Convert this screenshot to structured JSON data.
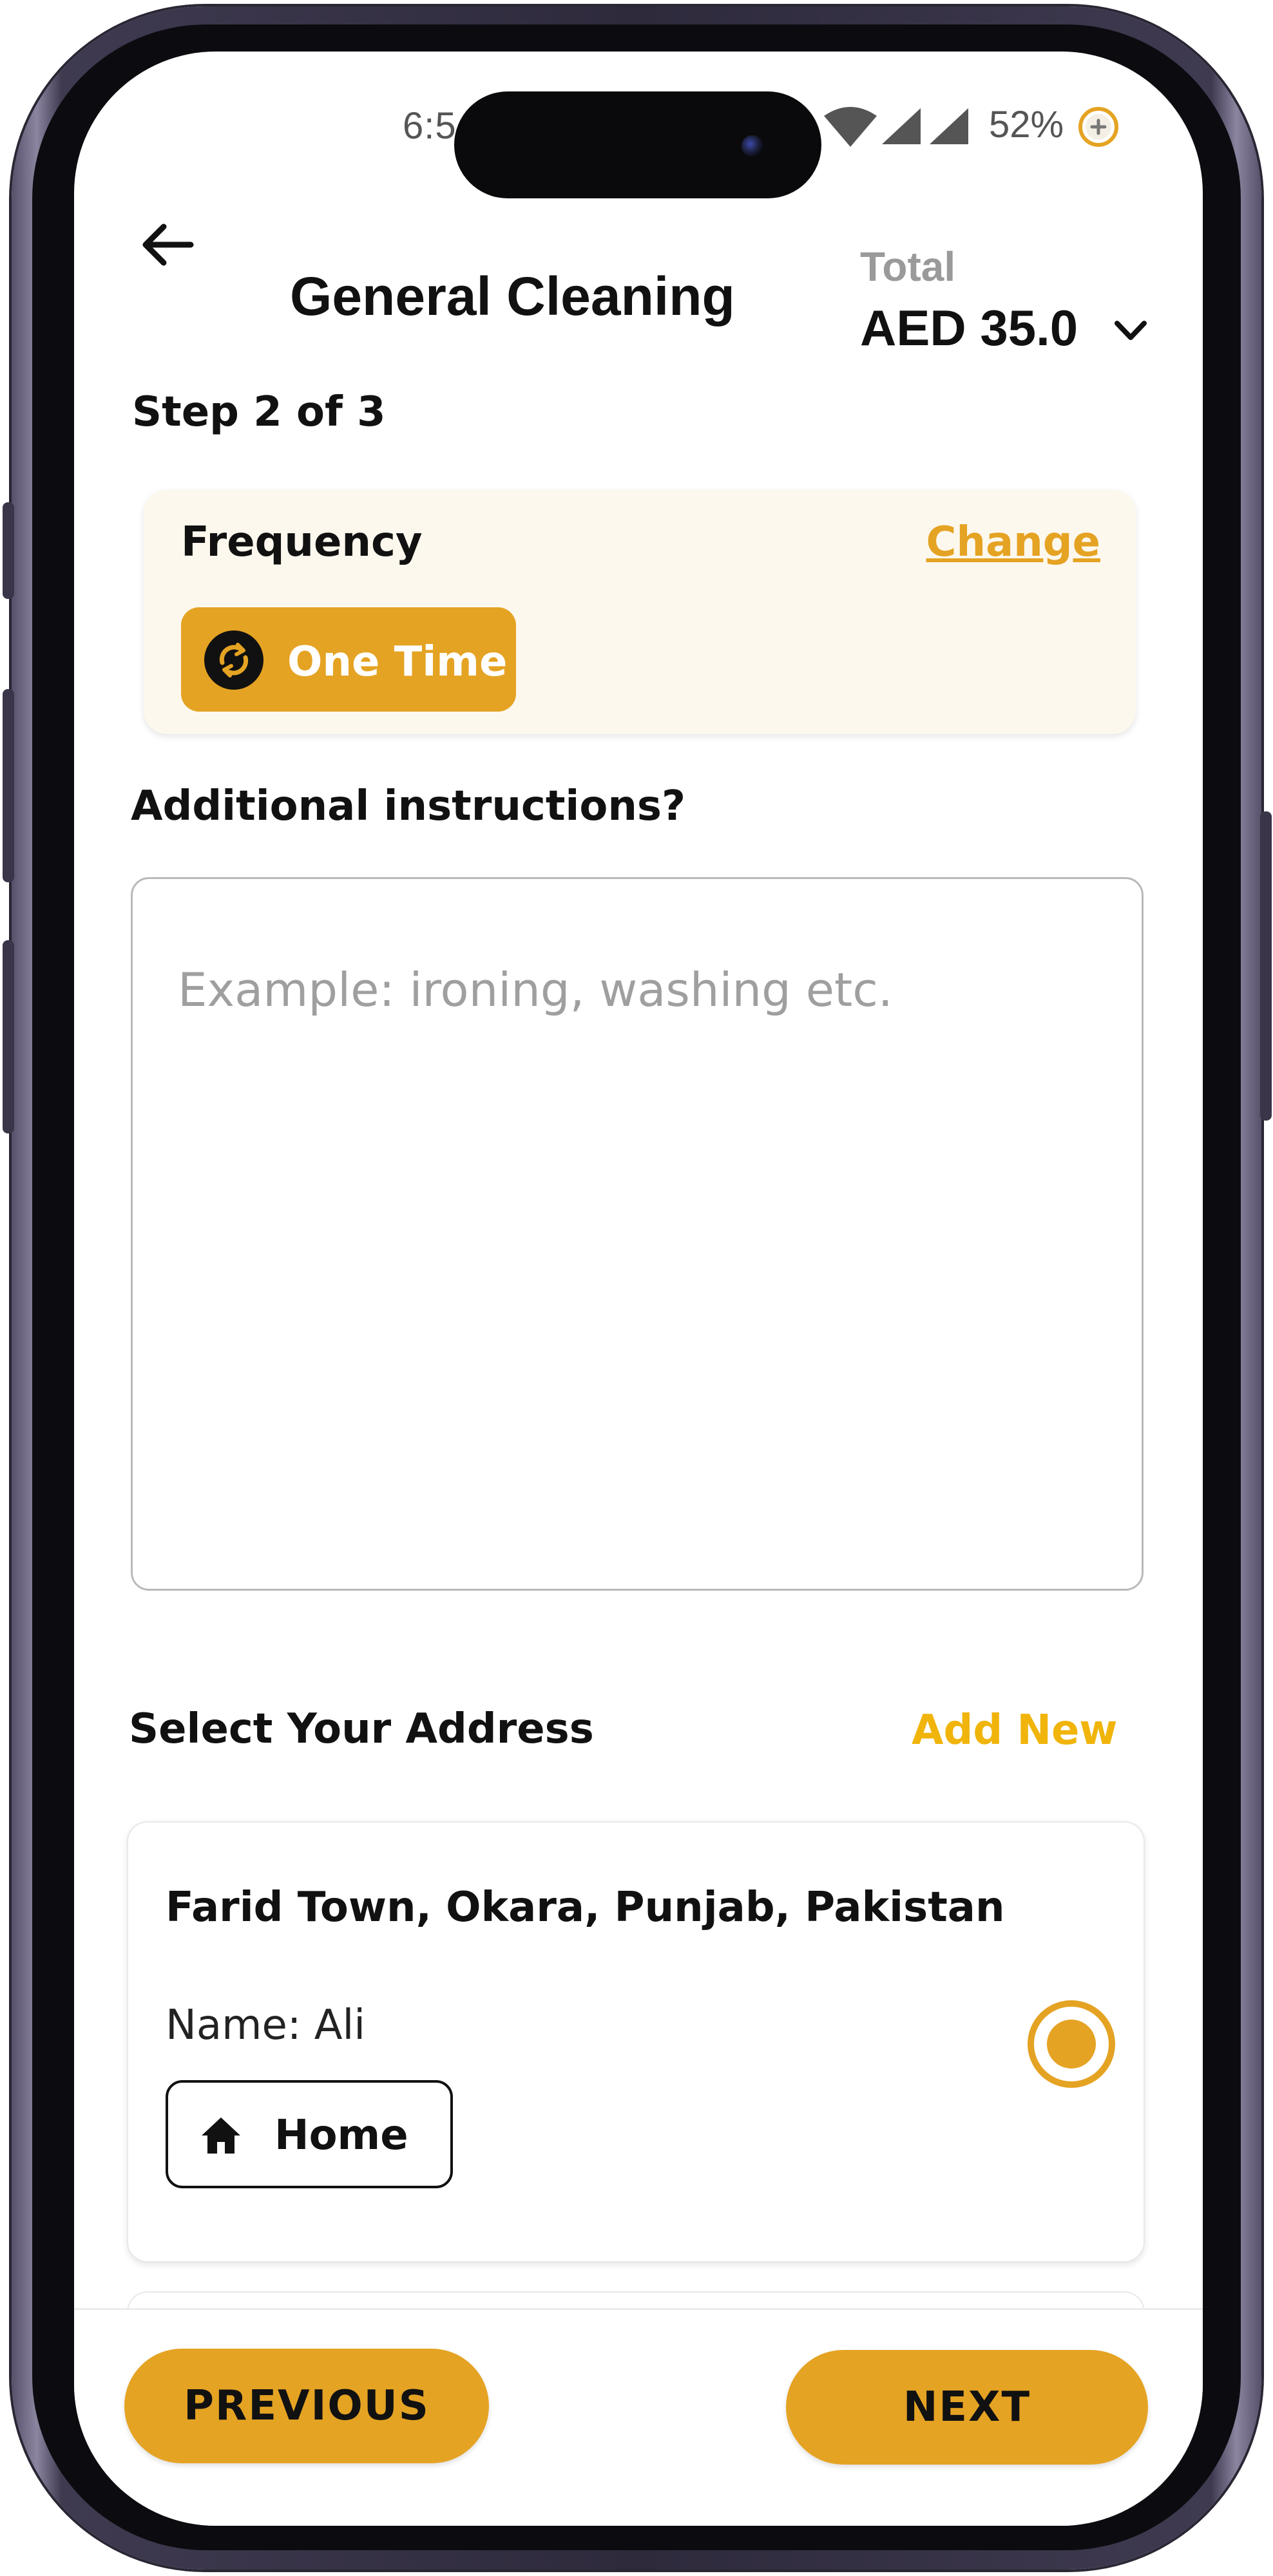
{
  "status_bar": {
    "time": "6:5",
    "battery_percent": "52%"
  },
  "header": {
    "title": "General Cleaning",
    "total_label": "Total",
    "total_amount": "AED 35.0"
  },
  "step": "Step 2 of 3",
  "frequency": {
    "label": "Frequency",
    "change_label": "Change",
    "selected_option": "One Time"
  },
  "instructions": {
    "label": "Additional instructions?",
    "placeholder": "Example: ironing, washing etc.",
    "value": ""
  },
  "address": {
    "section_label": "Select Your Address",
    "add_new_label": "Add New",
    "items": [
      {
        "line": "Farid Town, Okara, Punjab, Pakistan",
        "name": "Name: Ali",
        "tag": "Home",
        "selected": true
      }
    ]
  },
  "footer": {
    "previous_label": "PREVIOUS",
    "next_label": "NEXT"
  },
  "colors": {
    "accent": "#e5a323",
    "add_new": "#f0b40a",
    "card_bg": "#fdf8ee"
  },
  "icons": {
    "back": "arrow-left-icon",
    "total_toggle": "chevron-down-icon",
    "frequency": "repeat-icon",
    "address_tag": "home-icon"
  }
}
